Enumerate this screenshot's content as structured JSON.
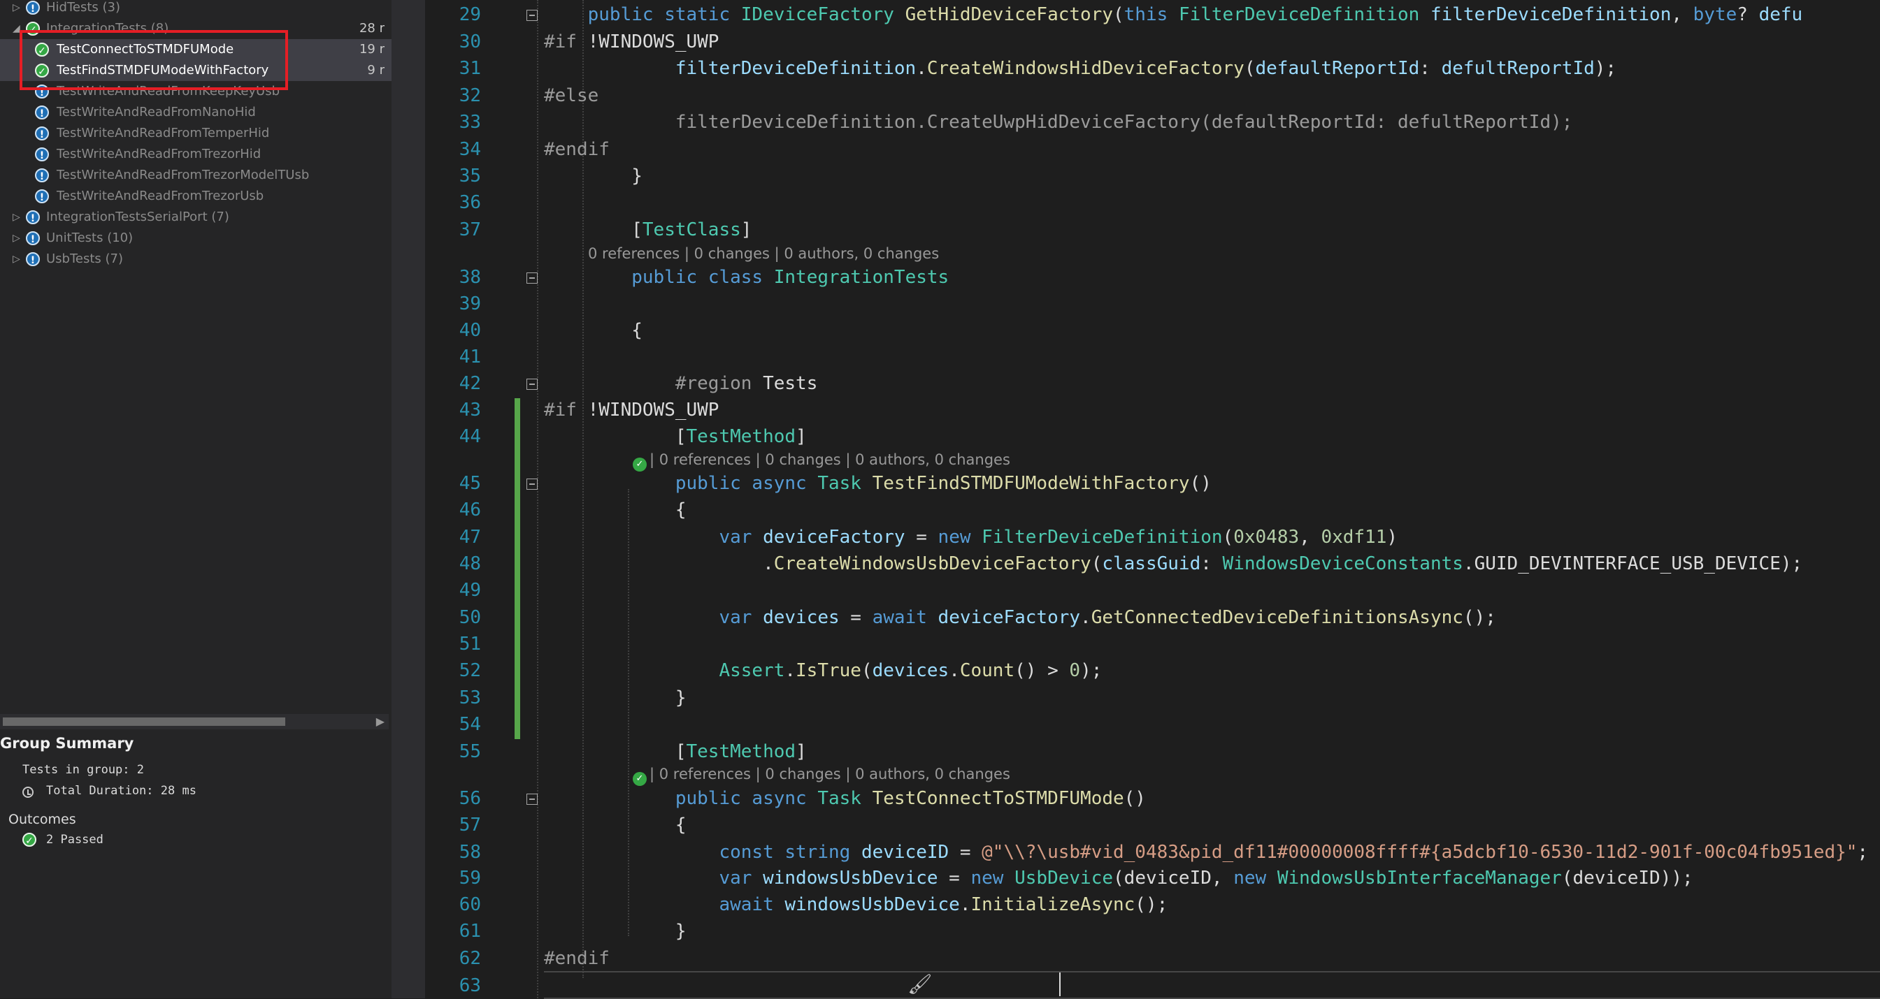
{
  "test_explorer": {
    "tree": [
      {
        "label": "HidTests (3)",
        "duration": "",
        "level": 0,
        "status": "notrun",
        "expander": "▷",
        "selected": false
      },
      {
        "label": "IntegrationTests (8)",
        "duration": "28 r",
        "level": 0,
        "status": "pass",
        "expander": "◢",
        "selected": false
      },
      {
        "label": "TestConnectToSTMDFUMode",
        "duration": "19 r",
        "level": 1,
        "status": "pass",
        "expander": "",
        "selected": true
      },
      {
        "label": "TestFindSTMDFUModeWithFactory",
        "duration": "9 r",
        "level": 1,
        "status": "pass",
        "expander": "",
        "selected": true
      },
      {
        "label": "TestWriteAndReadFromKeepKeyUsb",
        "duration": "",
        "level": 1,
        "status": "notrun",
        "expander": "",
        "selected": false
      },
      {
        "label": "TestWriteAndReadFromNanoHid",
        "duration": "",
        "level": 1,
        "status": "notrun",
        "expander": "",
        "selected": false
      },
      {
        "label": "TestWriteAndReadFromTemperHid",
        "duration": "",
        "level": 1,
        "status": "notrun",
        "expander": "",
        "selected": false
      },
      {
        "label": "TestWriteAndReadFromTrezorHid",
        "duration": "",
        "level": 1,
        "status": "notrun",
        "expander": "",
        "selected": false
      },
      {
        "label": "TestWriteAndReadFromTrezorModelTUsb",
        "duration": "",
        "level": 1,
        "status": "notrun",
        "expander": "",
        "selected": false
      },
      {
        "label": "TestWriteAndReadFromTrezorUsb",
        "duration": "",
        "level": 1,
        "status": "notrun",
        "expander": "",
        "selected": false
      },
      {
        "label": "IntegrationTestsSerialPort (7)",
        "duration": "",
        "level": 0,
        "status": "notrun",
        "expander": "▷",
        "selected": false
      },
      {
        "label": "UnitTests (10)",
        "duration": "",
        "level": 0,
        "status": "notrun",
        "expander": "▷",
        "selected": false
      },
      {
        "label": "UsbTests (7)",
        "duration": "",
        "level": 0,
        "status": "notrun",
        "expander": "▷",
        "selected": false
      }
    ],
    "group_summary": {
      "title": "Group Summary",
      "tests_in_group": "Tests in group: 2",
      "total_duration": "Total Duration: 28 ms",
      "outcomes_label": "Outcomes",
      "passed": "2 Passed"
    }
  },
  "editor": {
    "lines": [
      {
        "num": "29",
        "fold": true,
        "segs": [
          [
            "    public ",
            "kw"
          ],
          [
            "static ",
            "kw"
          ],
          [
            "IDeviceFactory ",
            "ty"
          ],
          [
            "GetHidDeviceFactory",
            "mt"
          ],
          [
            "(",
            "pl"
          ],
          [
            "this ",
            "kw"
          ],
          [
            "FilterDeviceDefinition ",
            "ty"
          ],
          [
            "filterDeviceDefinition",
            "id"
          ],
          [
            ", ",
            "pl"
          ],
          [
            "byte",
            "kw"
          ],
          [
            "? ",
            "pl"
          ],
          [
            "defu",
            "id"
          ]
        ]
      },
      {
        "num": "30",
        "fold": false,
        "segs": [
          [
            "#if ",
            "pp"
          ],
          [
            "!WINDOWS_UWP",
            "pl"
          ]
        ]
      },
      {
        "num": "31",
        "fold": false,
        "segs": [
          [
            "            filterDeviceDefinition",
            "id"
          ],
          [
            ".",
            "pl"
          ],
          [
            "CreateWindowsHidDeviceFactory",
            "mt"
          ],
          [
            "(",
            "pl"
          ],
          [
            "defaultReportId",
            "id"
          ],
          [
            ": ",
            "pl"
          ],
          [
            "defultReportId",
            "id"
          ],
          [
            ");",
            "pl"
          ]
        ]
      },
      {
        "num": "32",
        "fold": false,
        "segs": [
          [
            "#else",
            "pp"
          ]
        ]
      },
      {
        "num": "33",
        "fold": false,
        "segs": [
          [
            "            filterDeviceDefinition.CreateUwpHidDeviceFactory(defaultReportId: defultReportId);",
            "gr"
          ]
        ]
      },
      {
        "num": "34",
        "fold": false,
        "segs": [
          [
            "#endif",
            "pp"
          ]
        ]
      },
      {
        "num": "35",
        "fold": false,
        "segs": [
          [
            "        }",
            "pl"
          ]
        ]
      },
      {
        "num": "36",
        "fold": false,
        "segs": []
      },
      {
        "num": "37",
        "fold": false,
        "segs": [
          [
            "        [",
            "pl"
          ],
          [
            "TestClass",
            "ty"
          ],
          [
            "]",
            "pl"
          ]
        ]
      },
      {
        "num": "38",
        "fold": true,
        "segs": [
          [
            "        public ",
            "kw"
          ],
          [
            "class ",
            "kw"
          ],
          [
            "IntegrationTests",
            "ty"
          ]
        ]
      },
      {
        "num": "39",
        "fold": false,
        "segs": []
      },
      {
        "num": "40",
        "fold": false,
        "segs": [
          [
            "        {",
            "pl"
          ]
        ]
      },
      {
        "num": "41",
        "fold": false,
        "segs": []
      },
      {
        "num": "42",
        "fold": true,
        "segs": [
          [
            "            #region ",
            "pp"
          ],
          [
            "Tests",
            "pl"
          ]
        ]
      },
      {
        "num": "43",
        "fold": false,
        "segs": [
          [
            "#if ",
            "pp"
          ],
          [
            "!WINDOWS_UWP",
            "pl"
          ]
        ]
      },
      {
        "num": "44",
        "fold": false,
        "segs": [
          [
            "            [",
            "pl"
          ],
          [
            "TestMethod",
            "ty"
          ],
          [
            "]",
            "pl"
          ]
        ]
      },
      {
        "num": "45",
        "fold": true,
        "segs": [
          [
            "            public ",
            "kw"
          ],
          [
            "async ",
            "kw"
          ],
          [
            "Task ",
            "ty"
          ],
          [
            "TestFindSTMDFUModeWithFactory",
            "mt"
          ],
          [
            "()",
            "pl"
          ]
        ]
      },
      {
        "num": "46",
        "fold": false,
        "segs": [
          [
            "            {",
            "pl"
          ]
        ]
      },
      {
        "num": "47",
        "fold": false,
        "segs": [
          [
            "                var ",
            "kw"
          ],
          [
            "deviceFactory",
            "id"
          ],
          [
            " = ",
            "pl"
          ],
          [
            "new ",
            "kw"
          ],
          [
            "FilterDeviceDefinition",
            "ty"
          ],
          [
            "(",
            "pl"
          ],
          [
            "0x0483",
            "nm"
          ],
          [
            ", ",
            "pl"
          ],
          [
            "0xdf11",
            "nm"
          ],
          [
            ")",
            "pl"
          ]
        ]
      },
      {
        "num": "48",
        "fold": false,
        "segs": [
          [
            "                    .",
            "pl"
          ],
          [
            "CreateWindowsUsbDeviceFactory",
            "mt"
          ],
          [
            "(",
            "pl"
          ],
          [
            "classGuid",
            "id"
          ],
          [
            ": ",
            "pl"
          ],
          [
            "WindowsDeviceConstants",
            "ty"
          ],
          [
            ".GUID_DEVINTERFACE_USB_DEVICE);",
            "pl"
          ]
        ]
      },
      {
        "num": "49",
        "fold": false,
        "segs": []
      },
      {
        "num": "50",
        "fold": false,
        "segs": [
          [
            "                var ",
            "kw"
          ],
          [
            "devices",
            "id"
          ],
          [
            " = ",
            "pl"
          ],
          [
            "await ",
            "kw"
          ],
          [
            "deviceFactory",
            "id"
          ],
          [
            ".",
            "pl"
          ],
          [
            "GetConnectedDeviceDefinitionsAsync",
            "mt"
          ],
          [
            "();",
            "pl"
          ]
        ]
      },
      {
        "num": "51",
        "fold": false,
        "segs": []
      },
      {
        "num": "52",
        "fold": false,
        "segs": [
          [
            "                Assert",
            "ty"
          ],
          [
            ".",
            "pl"
          ],
          [
            "IsTrue",
            "mt"
          ],
          [
            "(",
            "pl"
          ],
          [
            "devices",
            "id"
          ],
          [
            ".",
            "pl"
          ],
          [
            "Count",
            "mt"
          ],
          [
            "() > ",
            "pl"
          ],
          [
            "0",
            "nm"
          ],
          [
            ");",
            "pl"
          ]
        ]
      },
      {
        "num": "53",
        "fold": false,
        "segs": [
          [
            "            }",
            "pl"
          ]
        ]
      },
      {
        "num": "54",
        "fold": false,
        "segs": []
      },
      {
        "num": "55",
        "fold": false,
        "segs": [
          [
            "            [",
            "pl"
          ],
          [
            "TestMethod",
            "ty"
          ],
          [
            "]",
            "pl"
          ]
        ]
      },
      {
        "num": "56",
        "fold": true,
        "segs": [
          [
            "            public ",
            "kw"
          ],
          [
            "async ",
            "kw"
          ],
          [
            "Task ",
            "ty"
          ],
          [
            "TestConnectToSTMDFUMode",
            "mt"
          ],
          [
            "()",
            "pl"
          ]
        ]
      },
      {
        "num": "57",
        "fold": false,
        "segs": [
          [
            "            {",
            "pl"
          ]
        ]
      },
      {
        "num": "58",
        "fold": false,
        "segs": [
          [
            "                const ",
            "kw"
          ],
          [
            "string ",
            "kw"
          ],
          [
            "deviceID",
            "id"
          ],
          [
            " = ",
            "pl"
          ],
          [
            "@\"\\\\?\\usb#vid_0483&pid_df11#00000008ffff#{a5dcbf10-6530-11d2-901f-00c04fb951ed}\"",
            "st"
          ],
          [
            ";",
            "pl"
          ]
        ]
      },
      {
        "num": "59",
        "fold": false,
        "segs": [
          [
            "                var ",
            "kw"
          ],
          [
            "windowsUsbDevice",
            "id"
          ],
          [
            " = ",
            "pl"
          ],
          [
            "new ",
            "kw"
          ],
          [
            "UsbDevice",
            "ty"
          ],
          [
            "(deviceID, ",
            "pl"
          ],
          [
            "new ",
            "kw"
          ],
          [
            "WindowsUsbInterfaceManager",
            "ty"
          ],
          [
            "(deviceID));",
            "pl"
          ]
        ]
      },
      {
        "num": "60",
        "fold": false,
        "segs": [
          [
            "                await ",
            "kw"
          ],
          [
            "windowsUsbDevice",
            "id"
          ],
          [
            ".",
            "pl"
          ],
          [
            "InitializeAsync",
            "mt"
          ],
          [
            "();",
            "pl"
          ]
        ]
      },
      {
        "num": "61",
        "fold": false,
        "segs": [
          [
            "            }",
            "pl"
          ]
        ]
      },
      {
        "num": "62",
        "fold": false,
        "segs": [
          [
            "#endif",
            "pp"
          ]
        ]
      },
      {
        "num": "63",
        "fold": false,
        "segs": []
      }
    ],
    "codelens": {
      "class_lens": "0 references | 0 changes | 0 authors, 0 changes",
      "method1_lens": "| 0 references | 0 changes | 0 authors, 0 changes",
      "method2_lens": "| 0 references | 0 changes | 0 authors, 0 changes"
    },
    "colors": {
      "keyword": "#569cd6",
      "type": "#4ec9b0",
      "method": "#dcdcaa",
      "identifier": "#9cdcfe",
      "number": "#b5cea8",
      "string": "#d69d85",
      "preprocessor": "#9b9b9b",
      "line_number": "#2b91af",
      "change_bar": "#57a64a",
      "highlight_box": "#e51e25"
    },
    "icons": [
      "fold-collapse-icon",
      "test-pass-icon",
      "brush-icon"
    ]
  }
}
